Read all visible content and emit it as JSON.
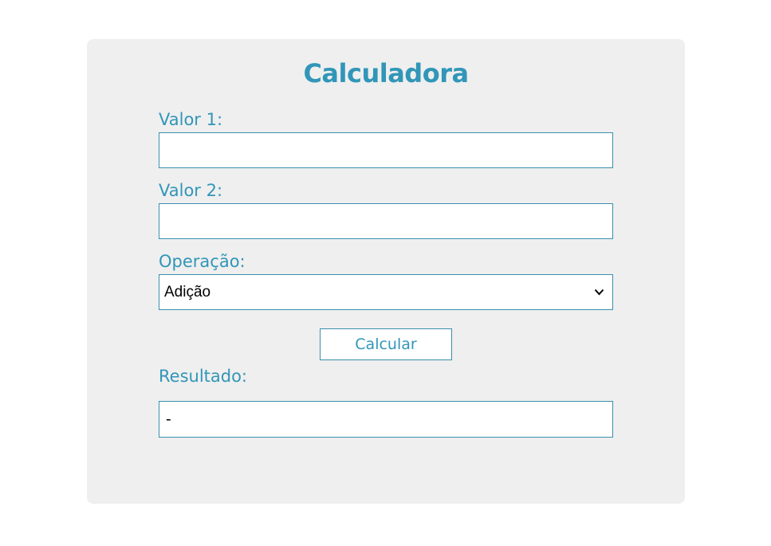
{
  "form": {
    "title": "Calculadora",
    "value1": {
      "label": "Valor 1:",
      "value": ""
    },
    "value2": {
      "label": "Valor 2:",
      "value": ""
    },
    "operation": {
      "label": "Operação:",
      "selected": "Adição"
    },
    "calculate_button": "Calcular",
    "result": {
      "label": "Resultado:",
      "value": "-"
    }
  },
  "colors": {
    "accent": "#3196b8",
    "border": "#3a8fad",
    "card_bg": "#efefef",
    "page_bg": "#ffffff"
  },
  "icons": {
    "select_arrow": "chevron-down-icon"
  }
}
